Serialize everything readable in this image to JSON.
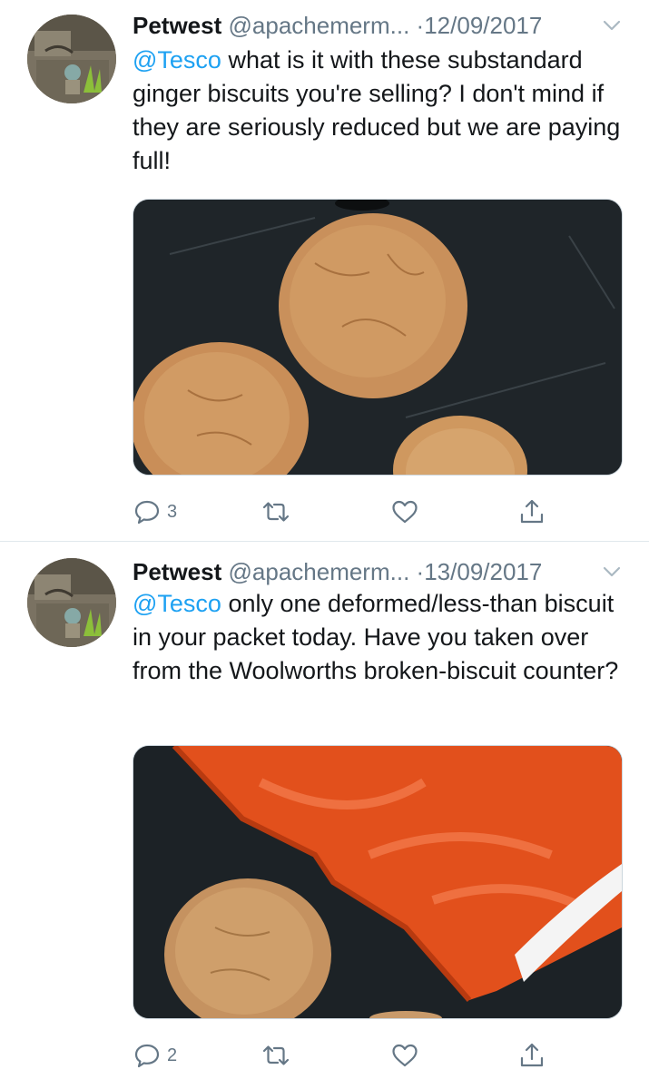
{
  "tweets": [
    {
      "author_name": "Petwest",
      "handle": "@apachemerm...",
      "separator": "·",
      "date": "12/09/2017",
      "mention": "@Tesco",
      "text": " what is it with these substandard ginger biscuits you're selling? I don't mind if they are seriously reduced but we are paying full!",
      "reply_count": "3",
      "retweet_count": "",
      "like_count": ""
    },
    {
      "author_name": "Petwest",
      "handle": "@apachemerm...",
      "separator": "·",
      "date": "13/09/2017",
      "mention": "@Tesco",
      "text": " only one deformed/less-than biscuit in your packet today.  Have you taken over from the Woolworths broken-biscuit counter?",
      "reply_count": "2",
      "retweet_count": "",
      "like_count": ""
    }
  ],
  "icons": {
    "reply": "speech-bubble-icon",
    "retweet": "retweet-arrows-icon",
    "like": "heart-icon",
    "share": "share-upload-icon",
    "more": "chevron-down-icon"
  },
  "colors": {
    "text": "#14171a",
    "secondary": "#657786",
    "link": "#1da1f2",
    "divider": "#e1e8ed"
  }
}
